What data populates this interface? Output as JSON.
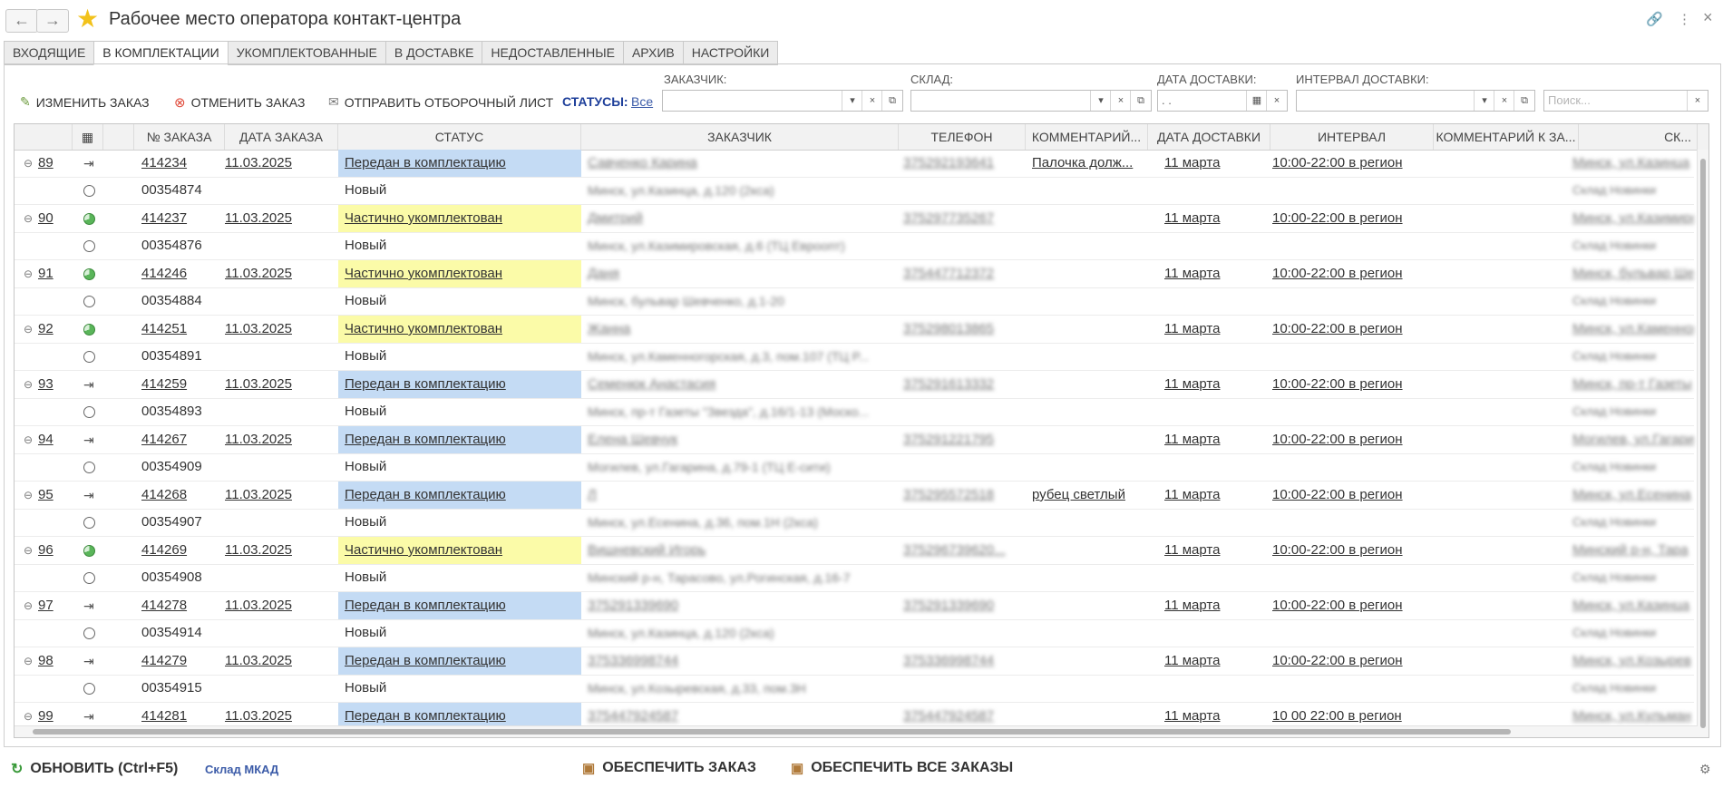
{
  "window": {
    "title": "Рабочее место оператора контакт-центра",
    "back_icon": "←",
    "forward_icon": "→",
    "link_icon": "🔗",
    "more_icon": "⋮",
    "close_icon": "×"
  },
  "tabs": [
    {
      "label": "ВХОДЯЩИЕ"
    },
    {
      "label": "В КОМПЛЕКТАЦИИ",
      "active": true
    },
    {
      "label": "УКОМПЛЕКТОВАННЫЕ"
    },
    {
      "label": "В ДОСТАВКЕ"
    },
    {
      "label": "НЕДОСТАВЛЕННЫЕ"
    },
    {
      "label": "АРХИВ"
    },
    {
      "label": "НАСТРОЙКИ"
    }
  ],
  "toolbar": {
    "edit_label": "ИЗМЕНИТЬ ЗАКАЗ",
    "cancel_label": "ОТМЕНИТЬ ЗАКАЗ",
    "send_label": "ОТПРАВИТЬ ОТБОРОЧНЫЙ ЛИСТ",
    "statuses_label": "СТАТУСЫ:",
    "statuses_value": "Все"
  },
  "filters": {
    "customer_label": "ЗАКАЗЧИК:",
    "warehouse_label": "СКЛАД:",
    "delivery_date_label": "ДАТА ДОСТАВКИ:",
    "delivery_date_value": " .  .",
    "interval_label": "ИНТЕРВАЛ ДОСТАВКИ:",
    "search_placeholder": "Поиск..."
  },
  "columns": [
    "№ ЗАКАЗА",
    "ДАТА ЗАКАЗА",
    "СТАТУС",
    "ЗАКАЗЧИК",
    "ТЕЛЕФОН",
    "КОММЕНТАРИЙ...",
    "ДАТА ДОСТАВКИ",
    "ИНТЕРВАЛ",
    "КОММЕНТАРИЙ К ЗА...",
    "СК..."
  ],
  "rows": [
    {
      "num": "89",
      "icon": "arrow",
      "order": "414234",
      "date": "11.03.2025",
      "status": "Передан в комплектацию",
      "kind": "blue",
      "customer": "Савченко Карина",
      "phone": "375292193641",
      "comment": "Палочка долж...",
      "delivery": "11 марта",
      "interval": "10:00-22:00 в регион",
      "warehouse": "Минск, ул.Казинца",
      "sub_order": "00354874",
      "sub_status": "Новый",
      "sub_address": "Минск, ул.Казинца, д.120 (2кса)",
      "sub_wh": "Склад Новинки"
    },
    {
      "num": "90",
      "icon": "pie",
      "order": "414237",
      "date": "11.03.2025",
      "status": "Частично укомплектован",
      "kind": "yellow",
      "customer": "Дмитрий",
      "phone": "375297735267",
      "comment": "",
      "delivery": "11 марта",
      "interval": "10:00-22:00 в регион",
      "warehouse": "Минск, ул.Казимировская",
      "sub_order": "00354876",
      "sub_status": "Новый",
      "sub_address": "Минск, ул.Казимировская, д.6 (ТЦ Евроопт)",
      "sub_wh": "Склад Новинки"
    },
    {
      "num": "91",
      "icon": "pie",
      "order": "414246",
      "date": "11.03.2025",
      "status": "Частично укомплектован",
      "kind": "yellow",
      "customer": "Даня",
      "phone": "375447712372",
      "comment": "",
      "delivery": "11 марта",
      "interval": "10:00-22:00 в регион",
      "warehouse": "Минск, бульвар Ше",
      "sub_order": "00354884",
      "sub_status": "Новый",
      "sub_address": "Минск, бульвар Шевченко, д.1-20",
      "sub_wh": "Склад Новинки"
    },
    {
      "num": "92",
      "icon": "pie",
      "order": "414251",
      "date": "11.03.2025",
      "status": "Частично укомплектован",
      "kind": "yellow",
      "customer": "Жанна",
      "phone": "375298013865",
      "comment": "",
      "delivery": "11 марта",
      "interval": "10:00-22:00 в регион",
      "warehouse": "Минск, ул.Каменног",
      "sub_order": "00354891",
      "sub_status": "Новый",
      "sub_address": "Минск, ул.Каменногорская, д.3, пом.107 (ТЦ Р...",
      "sub_wh": "Склад Новинки"
    },
    {
      "num": "93",
      "icon": "arrow",
      "order": "414259",
      "date": "11.03.2025",
      "status": "Передан в комплектацию",
      "kind": "blue",
      "customer": "Семенюк Анастасия",
      "phone": "375291613332",
      "comment": "",
      "delivery": "11 марта",
      "interval": "10:00-22:00 в регион",
      "warehouse": "Минск, пр-т Газеты",
      "sub_order": "00354893",
      "sub_status": "Новый",
      "sub_address": "Минск, пр-т Газеты \"Звезда\", д.16/1-13 (Моско...",
      "sub_wh": "Склад Новинки"
    },
    {
      "num": "94",
      "icon": "arrow",
      "order": "414267",
      "date": "11.03.2025",
      "status": "Передан в комплектацию",
      "kind": "blue",
      "customer": "Елена Шевчук",
      "phone": "375291221795",
      "comment": "",
      "delivery": "11 марта",
      "interval": "10:00-22:00 в регион",
      "warehouse": "Могилев, ул.Гагари",
      "sub_order": "00354909",
      "sub_status": "Новый",
      "sub_address": "Могилев, ул.Гагарина, д.79-1 (ТЦ Е-сити)",
      "sub_wh": "Склад Новинки"
    },
    {
      "num": "95",
      "icon": "arrow",
      "order": "414268",
      "date": "11.03.2025",
      "status": "Передан в комплектацию",
      "kind": "blue",
      "customer": "Л",
      "phone": "375295572518",
      "comment": "рубец светлый",
      "delivery": "11 марта",
      "interval": "10:00-22:00 в регион",
      "warehouse": "Минск, ул.Есенина",
      "sub_order": "00354907",
      "sub_status": "Новый",
      "sub_address": "Минск, ул.Есенина, д.36, пом.1Н (2кса)",
      "sub_wh": "Склад Новинки"
    },
    {
      "num": "96",
      "icon": "pie",
      "order": "414269",
      "date": "11.03.2025",
      "status": "Частично укомплектован",
      "kind": "yellow",
      "customer": "Вишневский Игорь",
      "phone": "375296739620...",
      "comment": "",
      "delivery": "11 марта",
      "interval": "10:00-22:00 в регион",
      "warehouse": "Минский р-н, Тара",
      "sub_order": "00354908",
      "sub_status": "Новый",
      "sub_address": "Минский р-н, Тарасово, ул.Рогинская, д.16-7",
      "sub_wh": "Склад Новинки"
    },
    {
      "num": "97",
      "icon": "arrow",
      "order": "414278",
      "date": "11.03.2025",
      "status": "Передан в комплектацию",
      "kind": "blue",
      "customer": "375291339690",
      "phone": "375291339690",
      "comment": "",
      "delivery": "11 марта",
      "interval": "10:00-22:00 в регион",
      "warehouse": "Минск, ул.Казинца",
      "sub_order": "00354914",
      "sub_status": "Новый",
      "sub_address": "Минск, ул.Казинца, д.120 (2кса)",
      "sub_wh": "Склад Новинки"
    },
    {
      "num": "98",
      "icon": "arrow",
      "order": "414279",
      "date": "11.03.2025",
      "status": "Передан в комплектацию",
      "kind": "blue",
      "customer": "375336998744",
      "phone": "375336998744",
      "comment": "",
      "delivery": "11 марта",
      "interval": "10:00-22:00 в регион",
      "warehouse": "Минск, ул.Козырев",
      "sub_order": "00354915",
      "sub_status": "Новый",
      "sub_address": "Минск, ул.Козыревская, д.33, пом.3Н",
      "sub_wh": "Склад Новинки"
    },
    {
      "num": "99",
      "icon": "arrow",
      "order": "414281",
      "date": "11.03.2025",
      "status": "Передан в комплектацию",
      "kind": "blue",
      "customer": "375447924587",
      "phone": "375447924587",
      "comment": "",
      "delivery": "11 марта",
      "interval": "10 00 22:00 в регион",
      "warehouse": "Минск, ул.Кульман",
      "sub_order": "",
      "sub_status": "",
      "sub_address": "",
      "sub_wh": ""
    }
  ],
  "footer": {
    "refresh_label": "ОБНОВИТЬ (Ctrl+F5)",
    "warehouse_link": "Склад МКАД",
    "provide_label": "ОБЕСПЕЧИТЬ ЗАКАЗ",
    "provide_all_label": "ОБЕСПЕЧИТЬ ВСЕ ЗАКАЗЫ"
  },
  "colors": {
    "blue_status": "#c4dbf4",
    "yellow_status": "#fbfba8",
    "link": "#3b5ba8"
  }
}
